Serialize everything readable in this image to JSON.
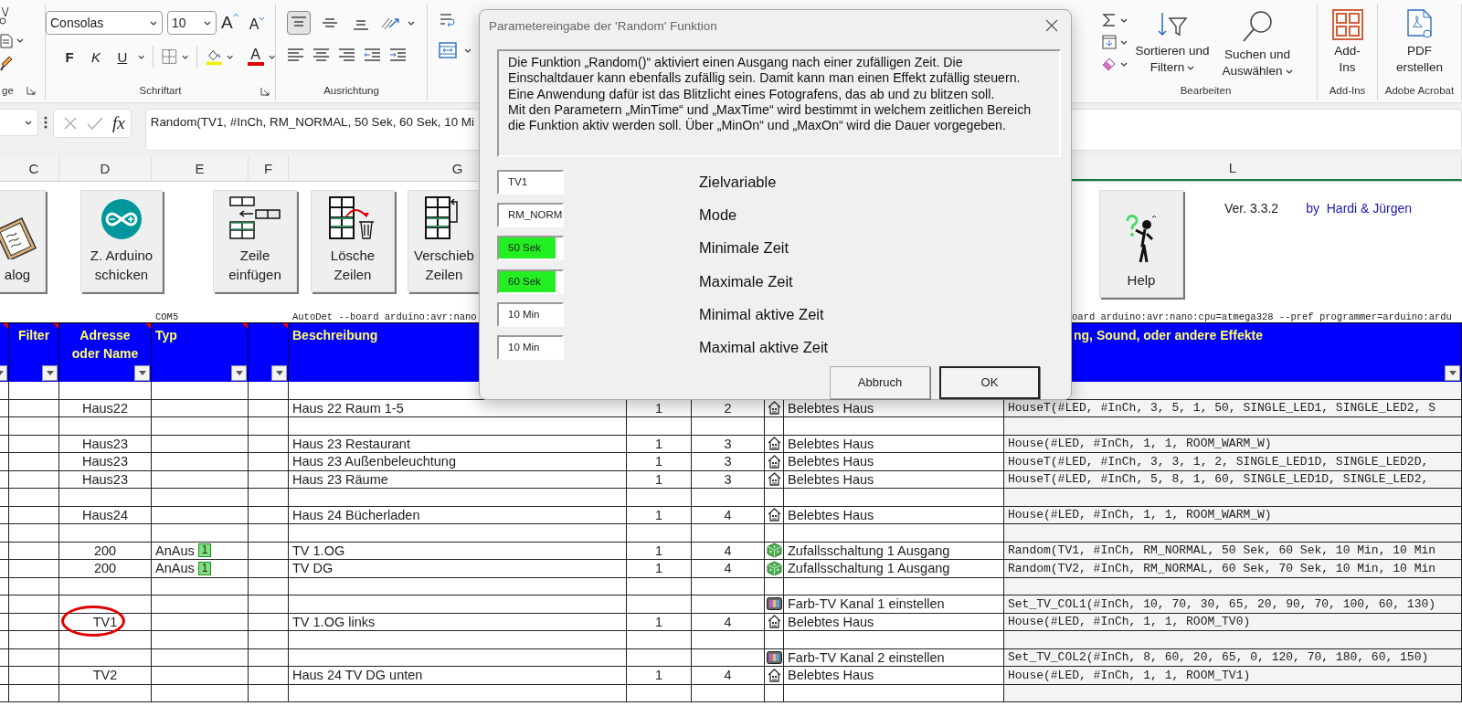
{
  "ribbon": {
    "clipboard": {
      "group_label": "ge"
    },
    "font": {
      "family": "Consolas",
      "size": "10",
      "grow": "A",
      "shrink": "A",
      "bold": "F",
      "italic": "K",
      "underline": "U",
      "font_color": "A",
      "group_label": "Schriftart"
    },
    "alignment": {
      "vertical": [
        {
          "selected": true
        },
        {
          "selected": false
        },
        {
          "selected": false
        }
      ],
      "group_label": "Ausrichtung"
    },
    "editing": {
      "sort": "Sortieren und\nFiltern",
      "find": "Suchen und\nAuswählen",
      "group_label": "Bearbeiten"
    },
    "addins": {
      "button": "Add-\nIns",
      "group_label": "Add-Ins"
    },
    "acrobat": {
      "button": "PDF\nerstellen",
      "group_label": "Adobe Acrobat"
    }
  },
  "formula_bar": {
    "fx": "fx",
    "formula": "Random(TV1, #InCh, RM_NORMAL, 50 Sek, 60 Sek, 10 Mi"
  },
  "column_headers": [
    {
      "label": "C",
      "selected": false
    },
    {
      "label": "D",
      "selected": false
    },
    {
      "label": "E",
      "selected": false
    },
    {
      "label": "F",
      "selected": false
    },
    {
      "label": "G",
      "selected": false
    },
    {
      "label": "L",
      "selected": true
    }
  ],
  "sheet": {
    "buttons": [
      {
        "label": "alog",
        "kind": "clipboard"
      },
      {
        "label": "Z. Arduino\nschicken",
        "kind": "arduino"
      },
      {
        "label": "Zeile\neinfügen",
        "kind": "insert"
      },
      {
        "label": "Lösche\nZeilen",
        "kind": "delete"
      },
      {
        "label": "Verschieb\nZeilen",
        "kind": "move"
      },
      {
        "label": "Help",
        "kind": "help"
      }
    ],
    "version": "Ver. 3.3.2",
    "authors": "by  Hardi & Jürgen",
    "port": "COM5",
    "command_left": "AutoDet --board arduino:avr:nano",
    "command_right": "oard arduino:avr:nano:cpu=atmega328 --pref programmer=arduino:ardu"
  },
  "table": {
    "header": [
      {
        "filter_button": true,
        "comment": true
      },
      {
        "label": "Filter",
        "filter_button": true,
        "comment": true
      },
      {
        "label": "Adresse\noder Name",
        "filter_button": true,
        "comment": true
      },
      {
        "label": "Typ",
        "filter_button": true,
        "comment": true
      },
      {
        "filter_button": true,
        "comment": true
      },
      {
        "label": "Beschreibung",
        "filter_button": false,
        "comment": false
      },
      {
        "label": "ng, Sound, oder andere Effekte",
        "filter_button": true,
        "comment": false
      }
    ],
    "rows": [
      {
        "circled": false
      },
      {
        "address": "Haus22",
        "description": "Haus 22 Raum 1-5",
        "column_7": "1",
        "column_8": "2",
        "kind": "house",
        "effect": "Belebtes Haus",
        "code": "HouseT(#LED, #InCh, 3, 5, 1, 50, SINGLE_LED1, SINGLE_LED2, S",
        "circled": false
      },
      {
        "circled": false
      },
      {
        "address": "Haus23",
        "description": "Haus 23 Restaurant",
        "column_7": "1",
        "column_8": "3",
        "kind": "house",
        "effect": "Belebtes Haus",
        "code": "House(#LED, #InCh, 1, 1, ROOM_WARM_W)",
        "circled": false
      },
      {
        "address": "Haus23",
        "description": "Haus 23 Außenbeleuchtung",
        "column_7": "1",
        "column_8": "3",
        "kind": "house",
        "effect": "Belebtes Haus",
        "code": "HouseT(#LED, #InCh, 3, 3, 1, 2, SINGLE_LED1D, SINGLE_LED2D,",
        "circled": false
      },
      {
        "address": "Haus23",
        "description": "Haus 23 Räume",
        "column_7": "1",
        "column_8": "3",
        "kind": "house",
        "effect": "Belebtes Haus",
        "code": "HouseT(#LED, #InCh, 5, 8, 1, 60, SINGLE_LED1D, SINGLE_LED2,",
        "circled": false
      },
      {
        "circled": false
      },
      {
        "address": "Haus24",
        "description": "Haus 24 Bücherladen",
        "column_7": "1",
        "column_8": "4",
        "kind": "house",
        "effect": "Belebtes Haus",
        "code": "House(#LED, #InCh, 1, 1, ROOM_WARM_W)",
        "circled": false
      },
      {
        "circled": false
      },
      {
        "address": "200",
        "type": "AnAus",
        "type_badge": "1",
        "description": "TV 1.OG",
        "column_7": "1",
        "column_8": "4",
        "kind": "dice",
        "effect": "Zufallsschaltung 1 Ausgang",
        "code": "Random(TV1, #InCh, RM_NORMAL, 50 Sek, 60 Sek, 10 Min, 10 Min",
        "circled": false
      },
      {
        "address": "200",
        "type": "AnAus",
        "type_badge": "1",
        "description": "TV DG",
        "column_7": "1",
        "column_8": "4",
        "kind": "dice",
        "effect": "Zufallsschaltung 1 Ausgang",
        "code": "Random(TV2, #InCh, RM_NORMAL, 60 Sek, 70 Sek, 10 Min, 10 Min",
        "circled": false
      },
      {
        "circled": false
      },
      {
        "kind": "tv",
        "effect": "Farb-TV Kanal 1 einstellen",
        "code": "Set_TV_COL1(#InCh, 10, 70, 30, 65, 20, 90, 70, 100, 60, 130)",
        "circled": false
      },
      {
        "address": "TV1",
        "description": "TV 1.OG links",
        "column_7": "1",
        "column_8": "4",
        "kind": "house",
        "effect": "Belebtes Haus",
        "code": "House(#LED, #InCh, 1, 1, ROOM_TV0)",
        "circled": true
      },
      {
        "circled": false
      },
      {
        "kind": "tv",
        "effect": "Farb-TV Kanal 2 einstellen",
        "code": "Set_TV_COL2(#InCh, 8, 60, 20, 65, 0, 120, 70, 180, 60, 150)",
        "circled": false
      },
      {
        "address": "TV2",
        "description": "Haus 24 TV DG unten",
        "column_7": "1",
        "column_8": "4",
        "kind": "house",
        "effect": "Belebtes Haus",
        "code": "House(#LED, #InCh, 1, 1, ROOM_TV1)",
        "circled": false
      },
      {
        "circled": false
      }
    ]
  },
  "dialog": {
    "title": "Parametereingabe der 'Random' Funktion",
    "description": "Die Funktion „Random()“ aktiviert einen Ausgang nach einer zufälligen Zeit. Die\nEinschaltdauer kann ebenfalls zufällig sein. Damit kann man einen Effekt zufällig steuern.\nEine Anwendung dafür ist das Blitzlicht eines Fotografens, das ab und zu blitzen soll.\nMit den Parametern „MinTime“ und „MaxTime“ wird bestimmt in welchem zeitlichen Bereich\ndie Funktion aktiv werden soll. Über „MinOn“ und „MaxOn“ wird die Dauer vorgegeben.",
    "parameters": [
      {
        "value": "TV1",
        "label": "Zielvariable",
        "highlighted": false
      },
      {
        "value": "RM_NORM",
        "label": "Mode",
        "highlighted": false
      },
      {
        "value": "50 Sek",
        "label": "Minimale Zeit",
        "highlighted": true
      },
      {
        "value": "60 Sek",
        "label": "Maximale Zeit",
        "highlighted": true
      },
      {
        "value": "10 Min",
        "label": "Minimal aktive Zeit",
        "highlighted": false
      },
      {
        "value": "10 Min",
        "label": "Maximal aktive Zeit",
        "highlighted": false
      }
    ],
    "buttons": [
      {
        "label": "Abbruch",
        "default": false
      },
      {
        "label": "OK",
        "default": true
      }
    ]
  }
}
